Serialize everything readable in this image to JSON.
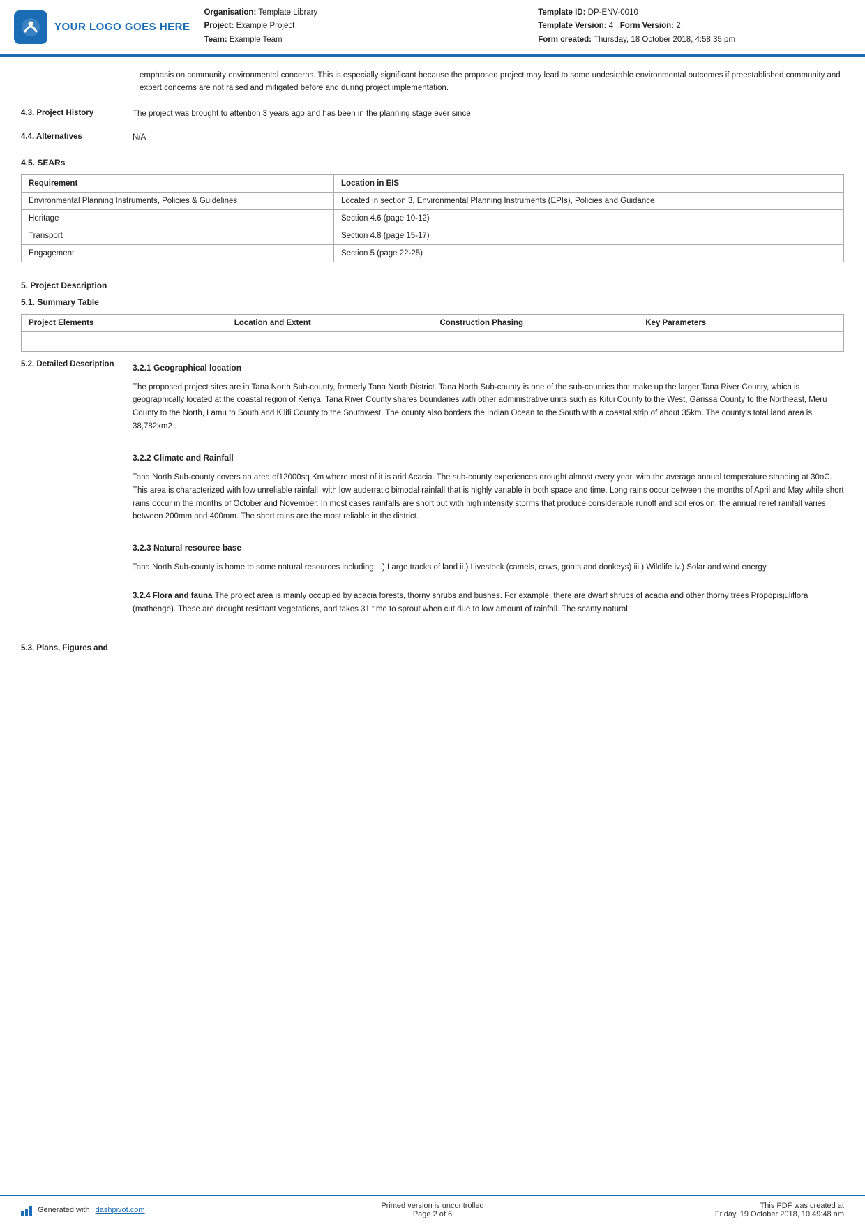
{
  "header": {
    "logo_text": "YOUR LOGO GOES HERE",
    "org_label": "Organisation:",
    "org_value": "Template Library",
    "project_label": "Project:",
    "project_value": "Example Project",
    "team_label": "Team:",
    "team_value": "Example Team",
    "template_id_label": "Template ID:",
    "template_id_value": "DP-ENV-0010",
    "template_version_label": "Template Version:",
    "template_version_value": "4",
    "form_version_label": "Form Version:",
    "form_version_value": "2",
    "form_created_label": "Form created:",
    "form_created_value": "Thursday, 18 October 2018, 4:58:35 pm"
  },
  "intro_text": "emphasis on community environmental concerns. This is especially significant because the proposed project may lead to some undesirable environmental outcomes if preestablished community and expert concerns are not raised and mitigated before and during project implementation.",
  "section_43": {
    "label": "4.3. Project History",
    "content": "The project was brought to attention 3 years ago and has been in the planning stage ever since"
  },
  "section_44": {
    "label": "4.4. Alternatives",
    "content": "N/A"
  },
  "section_45": {
    "label": "4.5. SEARs",
    "table": {
      "headers": [
        "Requirement",
        "Location in EIS"
      ],
      "rows": [
        [
          "Environmental Planning Instruments, Policies & Guidelines",
          "Located in section 3, Environmental Planning Instruments (EPIs), Policies and Guidance"
        ],
        [
          "Heritage",
          "Section 4.6 (page 10-12)"
        ],
        [
          "Transport",
          "Section 4.8 (page 15-17)"
        ],
        [
          "Engagement",
          "Section 5 (page 22-25)"
        ]
      ]
    }
  },
  "section_5": {
    "label": "5. Project Description"
  },
  "section_51": {
    "label": "5.1. Summary Table",
    "table": {
      "headers": [
        "Project Elements",
        "Location and Extent",
        "Construction Phasing",
        "Key Parameters"
      ],
      "rows": [
        [
          "",
          "",
          "",
          ""
        ]
      ]
    }
  },
  "section_52": {
    "label": "5.2. Detailed Description",
    "subsections": [
      {
        "heading": "3.2.1 Geographical location",
        "text": "The proposed project sites are in Tana North Sub-county, formerly Tana North District. Tana North Sub-county is one of the sub-counties that make up the larger Tana River County, which is geographically located at the coastal region of Kenya. Tana River County shares boundaries with other administrative units such as Kitui County to the West, Garissa County to the Northeast, Meru County to the North, Lamu to South and Kilifi County to the Southwest. The county also borders the Indian Ocean to the South with a coastal strip of about 35km. The county's total land area is 38,782km2 ."
      },
      {
        "heading": "3.2.2 Climate and Rainfall",
        "text": "Tana North Sub-county covers an area of12000sq Km where most of it is arid Acacia. The sub-county experiences drought almost every year, with the average annual temperature standing at 30oC. This area is characterized with low unreliable rainfall, with low auderratic bimodal rainfall that is highly variable in both space and time. Long rains occur between the months of April and May while short rains occur in the months of October and November. In most cases rainfalls are short but with high intensity storms that produce considerable runoff and soil erosion, the annual relief rainfall varies between 200mm and 400mm. The short rains are the most reliable in the district."
      },
      {
        "heading": "3.2.3 Natural resource base",
        "text": "Tana North Sub-county is home to some natural resources including: i.) Large tracks of land ii.) Livestock (camels, cows, goats and donkeys) iii.) Wildlife iv.) Solar and wind energy"
      },
      {
        "heading": "3.2.4 Flora and fauna",
        "inline_bold": true,
        "text": "The project area is mainly occupied by acacia forests, thorny shrubs and bushes. For example, there are dwarf shrubs of acacia and other thorny trees Propopisjuliflora (mathenge). These are drought resistant vegetations, and takes 31 time to sprout when cut due to low amount of rainfall. The scanty natural"
      }
    ]
  },
  "section_53": {
    "label": "5.3. Plans, Figures and"
  },
  "footer": {
    "generated_text": "Generated with ",
    "dashpivot_link": "dashpivot.com",
    "center_text": "Printed version is uncontrolled",
    "page_text": "Page 2 of 6",
    "right_text": "This PDF was created at",
    "right_date": "Friday, 19 October 2018, 10:49:48 am"
  }
}
